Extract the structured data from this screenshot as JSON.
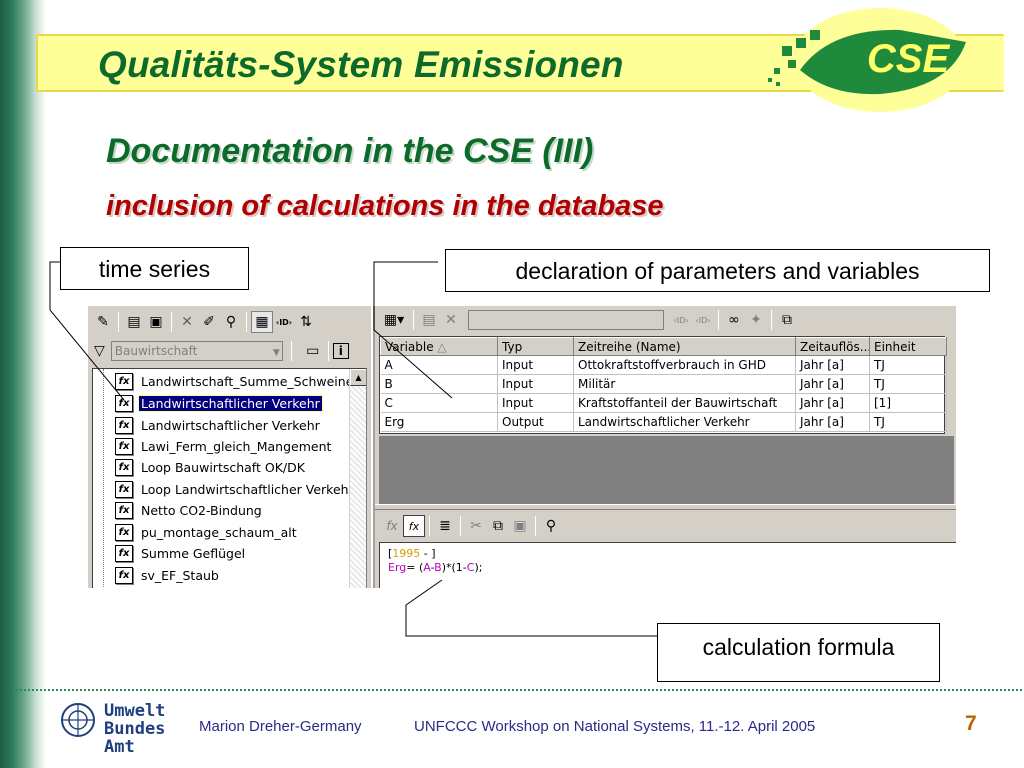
{
  "header": {
    "title": "Qualitäts-System Emissionen",
    "logo_text": "CSE"
  },
  "slide": {
    "title": "Documentation in the CSE (III)",
    "subtitle": "inclusion of calculations in the database"
  },
  "callouts": {
    "time_series": "time series",
    "declaration": "declaration of parameters and variables",
    "formula": "calculation formula"
  },
  "left_panel": {
    "filter_value": "Bauwirtschaft",
    "items": [
      {
        "label": "Landwirtschaft_Summe_Schweine",
        "selected": false
      },
      {
        "label": "Landwirtschaftlicher Verkehr",
        "selected": true
      },
      {
        "label": "Landwirtschaftlicher Verkehr",
        "selected": false
      },
      {
        "label": "Lawi_Ferm_gleich_Mangement",
        "selected": false
      },
      {
        "label": "Loop Bauwirtschaft OK/DK",
        "selected": false
      },
      {
        "label": "Loop Landwirtschaftlicher Verkehr OK",
        "selected": false
      },
      {
        "label": "Netto CO2-Bindung",
        "selected": false
      },
      {
        "label": "pu_montage_schaum_alt",
        "selected": false
      },
      {
        "label": "Summe Geflügel",
        "selected": false
      },
      {
        "label": "sv_EF_Staub",
        "selected": false
      }
    ]
  },
  "variables_table": {
    "columns": [
      "Variable",
      "Typ",
      "Zeitreihe (Name)",
      "Zeitauflös...",
      "Einheit"
    ],
    "rows": [
      [
        "A",
        "Input",
        "Ottokraftstoffverbrauch in GHD",
        "Jahr [a]",
        "TJ"
      ],
      [
        "B",
        "Input",
        "Militär",
        "Jahr [a]",
        "TJ"
      ],
      [
        "C",
        "Input",
        "Kraftstoffanteil der Bauwirtschaft",
        "Jahr [a]",
        "[1]"
      ],
      [
        "Erg",
        "Output",
        "Landwirtschaftlicher Verkehr",
        "Jahr [a]",
        "TJ"
      ]
    ]
  },
  "formula": {
    "line1_open": "[",
    "line1_year": "1995",
    "line1_rest": " - ]",
    "erg": "Erg",
    "eq": "= (",
    "a": "A",
    "minus": "-",
    "b": "B",
    "mid": ")*(1-",
    "c": "C",
    "end": ");"
  },
  "footer": {
    "org_line1": "Umwelt",
    "org_line2": "Bundes",
    "org_line3": "Amt",
    "author": "Marion Dreher-Germany",
    "event": "UNFCCC Workshop on National Systems, 11.-12. April 2005",
    "page": "7"
  },
  "colors": {
    "title_green": "#0c6b2a",
    "subtitle_red": "#b00000",
    "banner_yellow": "#ffff99",
    "footer_blue": "#2a2a8a",
    "page_orange": "#c06000"
  }
}
